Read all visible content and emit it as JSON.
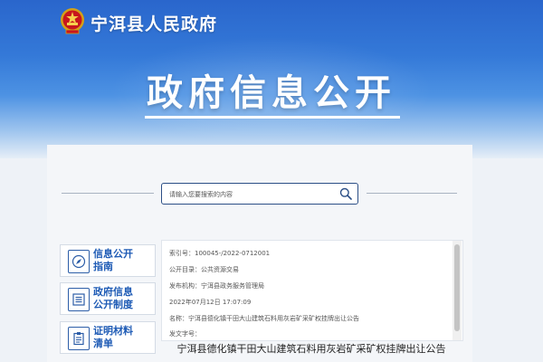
{
  "header": {
    "site_title": "宁洱县人民政府",
    "banner_title": "政府信息公开",
    "emblem_icon": "national-emblem-icon"
  },
  "search": {
    "placeholder": "请输入您要搜索的内容",
    "icon": "search-icon"
  },
  "sidebar": {
    "items": [
      {
        "line1": "信息公开",
        "line2": "指南",
        "icon": "compass-icon"
      },
      {
        "line1": "政府信息",
        "line2": "公开制度",
        "icon": "list-icon"
      },
      {
        "line1": "证明材料",
        "line2": "清单",
        "icon": "clipboard-icon"
      }
    ]
  },
  "info": {
    "rows": [
      {
        "label": "索引号：",
        "value": "100045-/2022-0712001"
      },
      {
        "label": "公开目录：",
        "value": "公共资源交易"
      },
      {
        "label": "发布机构：",
        "value": "宁洱县政务服务管理局"
      },
      {
        "label": "",
        "value": "2022年07月12日 17:07:09"
      },
      {
        "label": "名称：",
        "value": "宁洱县德化镇干田大山建筑石料用灰岩矿采矿权挂牌出让公告"
      },
      {
        "label": "发文字号：",
        "value": ""
      }
    ]
  },
  "document": {
    "title": "宁洱县德化镇干田大山建筑石料用灰岩矿采矿权挂牌出让公告"
  },
  "colors": {
    "banner_blue": "#3479d8",
    "link_blue": "#1e5bb5",
    "panel_bg": "#f4f6f9",
    "search_border": "#2c4f86"
  }
}
